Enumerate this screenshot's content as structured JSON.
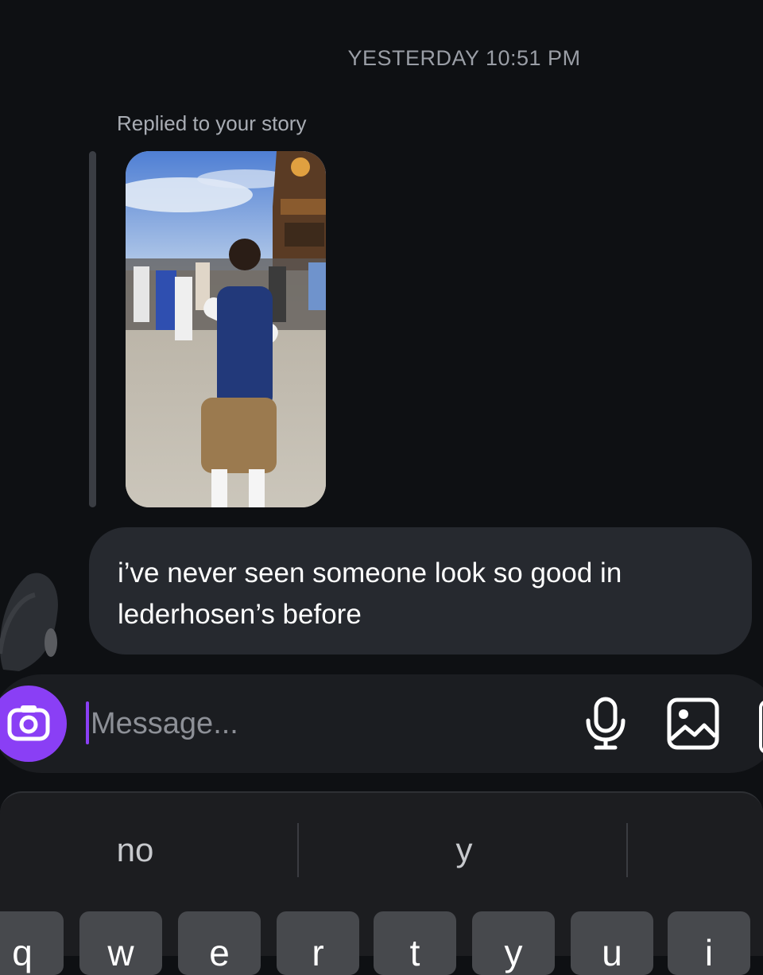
{
  "thread": {
    "timestamp": "YESTERDAY 10:51 PM",
    "reply_label": "Replied to your story",
    "message": "i’ve never seen someone look so good in lederhosen’s before"
  },
  "composer": {
    "placeholder": "Message...",
    "value": "",
    "icons": [
      "camera-icon",
      "microphone-icon",
      "gallery-icon",
      "sticker-icon"
    ],
    "accent": "#8a3ff5"
  },
  "keyboard": {
    "suggestions": [
      "no",
      "y",
      ""
    ],
    "keys": [
      "q",
      "w",
      "e",
      "r",
      "t",
      "y",
      "u",
      "i"
    ]
  }
}
